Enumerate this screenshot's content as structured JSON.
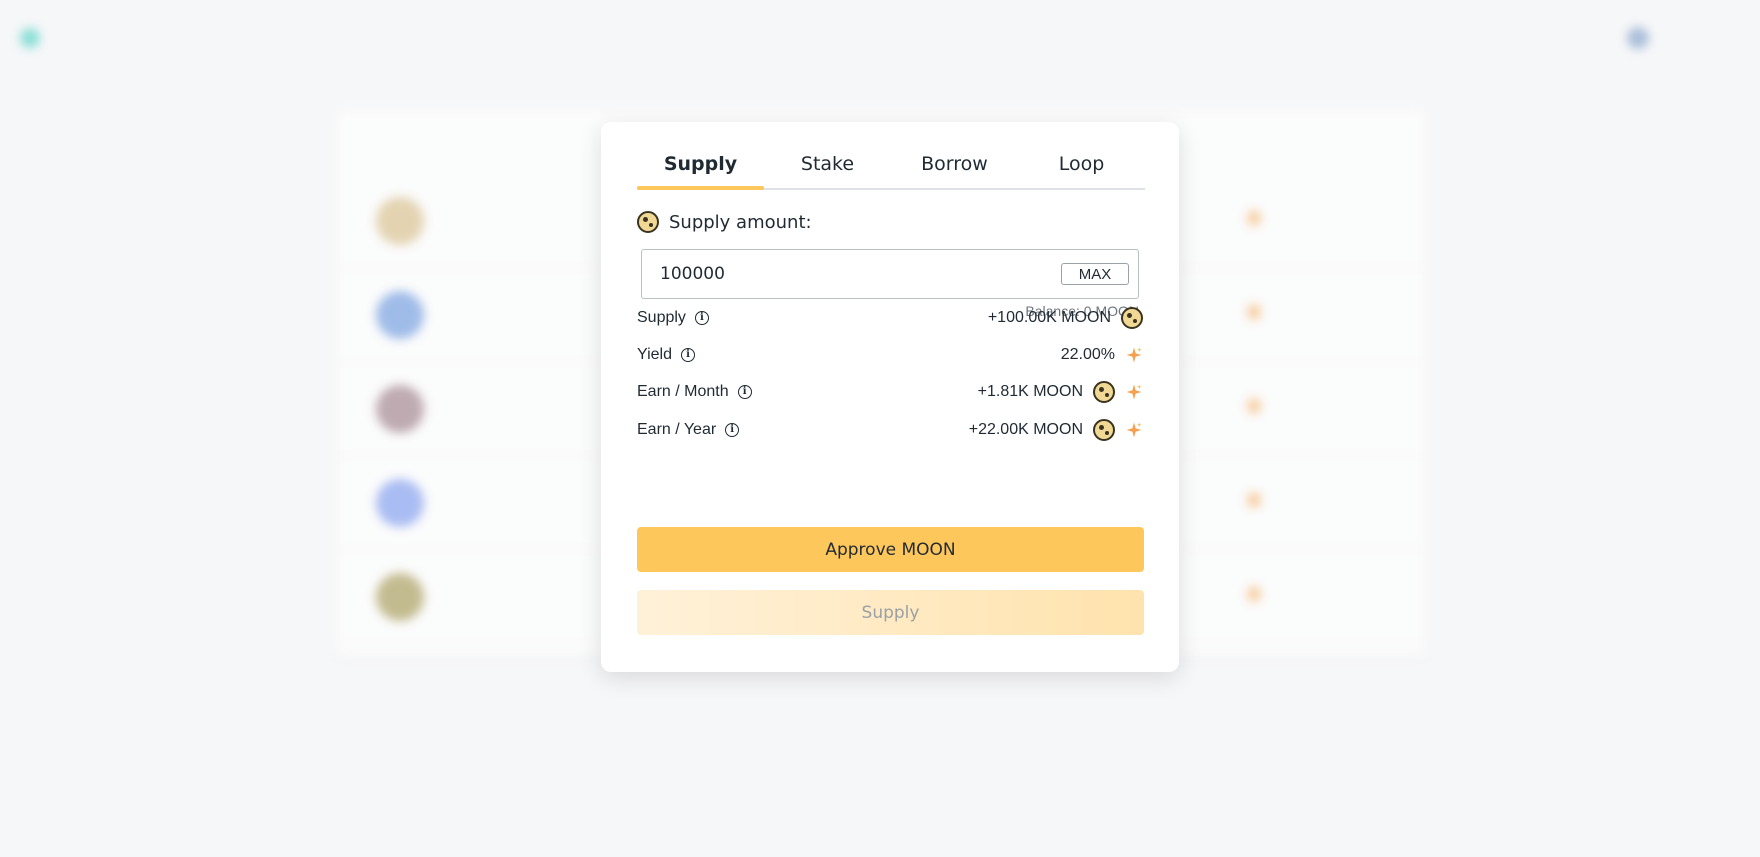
{
  "modal": {
    "tabs": [
      {
        "label": "Supply",
        "active": true
      },
      {
        "label": "Stake",
        "active": false
      },
      {
        "label": "Borrow",
        "active": false
      },
      {
        "label": "Loop",
        "active": false
      }
    ],
    "supply_label": "Supply amount:",
    "amount_value": "100000",
    "max_label": "MAX",
    "balance": "Balance: 0 MOON",
    "stats": [
      {
        "label": "Supply",
        "value": "+100.00K MOON",
        "icons": [
          "moon-coin-icon"
        ]
      },
      {
        "label": "Yield",
        "value": "22.00%",
        "icons": [
          "sparkle-icon"
        ]
      },
      {
        "label": "Earn / Month",
        "value": "+1.81K MOON",
        "icons": [
          "moon-coin-icon",
          "sparkle-icon"
        ]
      },
      {
        "label": "Earn / Year",
        "value": "+22.00K MOON",
        "icons": [
          "moon-coin-icon",
          "sparkle-icon"
        ]
      }
    ],
    "approve_label": "Approve MOON",
    "supply_button_label": "Supply"
  },
  "colors": {
    "accent": "#fec75b",
    "accent_light": "#ffe9c2",
    "background": "#f6f7f9"
  }
}
